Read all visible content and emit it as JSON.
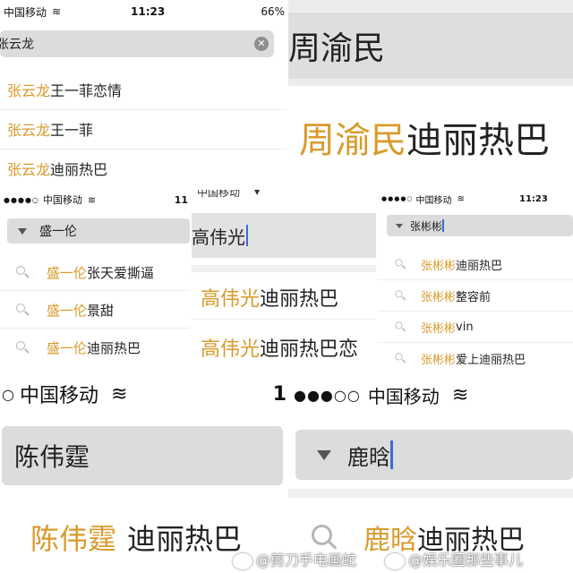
{
  "panel1": {
    "status": {
      "carrier": "中国移动",
      "time": "11:23",
      "battery": "66%"
    },
    "search_value": "张云龙",
    "suggestions": [
      {
        "highlight": "张云龙",
        "rest": "王一菲恋情"
      },
      {
        "highlight": "张云龙",
        "rest": "王一菲"
      },
      {
        "highlight": "张云龙",
        "rest": "迪丽热巴"
      }
    ]
  },
  "panel2": {
    "search_value": "周渝民",
    "suggestion": {
      "highlight": "周渝民",
      "rest": "迪丽热巴"
    }
  },
  "panel3": {
    "status": {
      "signal": "●●●●○",
      "carrier": "中国移动",
      "time": "11"
    },
    "search_value": "盛一伦",
    "suggestions": [
      {
        "highlight": "盛一伦",
        "rest": "张天爱撕逼"
      },
      {
        "highlight": "盛一伦",
        "rest": "景甜"
      },
      {
        "highlight": "盛一伦",
        "rest": "迪丽热巴"
      }
    ]
  },
  "panel4": {
    "status": {
      "carrier": "中国移动"
    },
    "search_value": "高伟光",
    "suggestions": [
      {
        "highlight": "高伟光",
        "rest": "迪丽热巴"
      },
      {
        "highlight": "高伟光",
        "rest": "迪丽热巴恋"
      }
    ]
  },
  "panel5": {
    "status": {
      "signal": "●●●●○",
      "carrier": "中国移动",
      "time": "11:23"
    },
    "search_value": "张彬彬",
    "suggestions": [
      {
        "highlight": "张彬彬",
        "rest": "迪丽热巴"
      },
      {
        "highlight": "张彬彬",
        "rest": "整容前"
      },
      {
        "highlight": "张彬彬",
        "rest": "vin"
      },
      {
        "highlight": "张彬彬",
        "rest": "爱上迪丽热巴"
      }
    ]
  },
  "panel6": {
    "status": {
      "signal": "○",
      "carrier": "中国移动",
      "time": "1"
    },
    "search_value": "陈伟霆",
    "suggestion": {
      "highlight": "陈伟霆",
      "rest": "迪丽热巴"
    }
  },
  "panel7": {
    "status": {
      "signal": "●●●○○",
      "carrier": "中国移动"
    },
    "search_value": "鹿晗",
    "suggestion": {
      "highlight": "鹿晗",
      "rest": "迪丽热巴"
    }
  },
  "watermarks": {
    "left": "@剪刀手电画蛇",
    "right": "@娱乐圈那些事儿"
  },
  "colors": {
    "highlight": "#d99a2b",
    "search_bg": "#dcdcdc",
    "caret": "#3a6bd6"
  }
}
